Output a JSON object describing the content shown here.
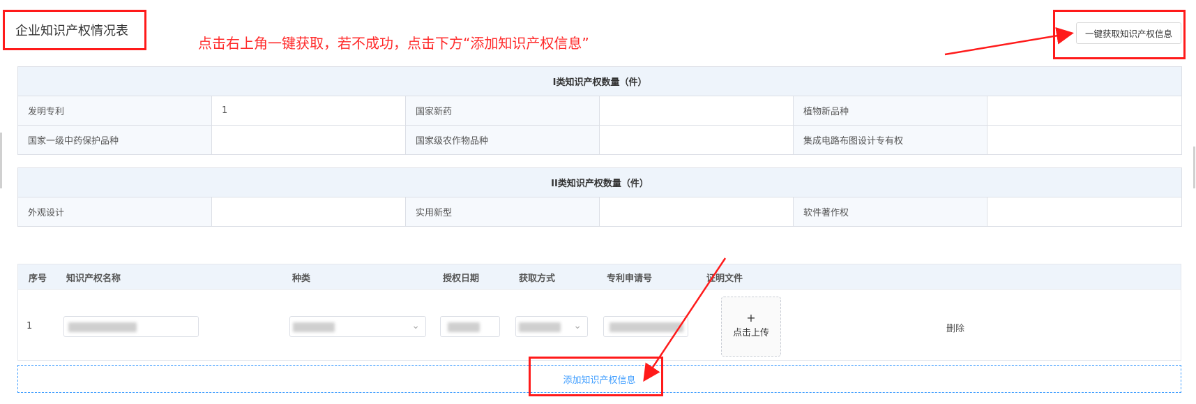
{
  "page": {
    "title": "企业知识产权情况表",
    "fetch_button": "一键获取知识产权信息"
  },
  "annotation": {
    "instruction": "点击右上角一键获取，若不成功，点击下方“添加知识产权信息”",
    "color": "#ff1a1a"
  },
  "class1": {
    "header": "I类知识产权数量（件）",
    "rows": [
      {
        "l1": "发明专利",
        "v1": "1",
        "l2": "国家新药",
        "v2": "",
        "l3": "植物新品种",
        "v3": ""
      },
      {
        "l1": "国家一级中药保护品种",
        "v1": "",
        "l2": "国家级农作物品种",
        "v2": "",
        "l3": "集成电路布图设计专有权",
        "v3": ""
      }
    ]
  },
  "class2": {
    "header": "II类知识产权数量（件）",
    "rows": [
      {
        "l1": "外观设计",
        "v1": "",
        "l2": "实用新型",
        "v2": "",
        "l3": "软件著作权",
        "v3": ""
      }
    ]
  },
  "ip_list": {
    "columns": {
      "index": "序号",
      "name": "知识产权名称",
      "type": "种类",
      "date": "授权日期",
      "method": "获取方式",
      "patent_no": "专利申请号",
      "proof": "证明文件"
    },
    "rows": [
      {
        "index": "1",
        "delete_label": "删除"
      }
    ],
    "upload": {
      "plus": "+",
      "label": "点击上传"
    },
    "add_label": "添加知识产权信息",
    "accent": "#409eff"
  }
}
